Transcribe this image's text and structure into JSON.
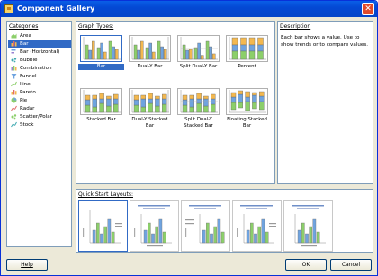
{
  "window": {
    "title": "Component Gallery",
    "close_glyph": "✕"
  },
  "categories": {
    "header": "Categories",
    "items": [
      {
        "label": "Area",
        "icon": "area-chart-icon"
      },
      {
        "label": "Bar",
        "icon": "bar-chart-icon",
        "selected": true
      },
      {
        "label": "Bar (Horizontal)",
        "icon": "horizontal-bar-chart-icon"
      },
      {
        "label": "Bubble",
        "icon": "bubble-chart-icon"
      },
      {
        "label": "Combination",
        "icon": "combination-chart-icon"
      },
      {
        "label": "Funnel",
        "icon": "funnel-chart-icon"
      },
      {
        "label": "Line",
        "icon": "line-chart-icon"
      },
      {
        "label": "Pareto",
        "icon": "pareto-chart-icon"
      },
      {
        "label": "Pie",
        "icon": "pie-chart-icon"
      },
      {
        "label": "Radar",
        "icon": "radar-chart-icon"
      },
      {
        "label": "Scatter/Polar",
        "icon": "scatter-chart-icon"
      },
      {
        "label": "Stock",
        "icon": "stock-chart-icon"
      }
    ]
  },
  "graph_types": {
    "header": "Graph Types:",
    "items": [
      {
        "label": "Bar",
        "selected": true
      },
      {
        "label": "Dual-Y Bar"
      },
      {
        "label": "Split Dual-Y Bar"
      },
      {
        "label": "Percent"
      },
      {
        "label": "Stacked Bar"
      },
      {
        "label": "Dual-Y Stacked Bar"
      },
      {
        "label": "Split Dual-Y Stacked Bar"
      },
      {
        "label": "Floating Stacked Bar"
      }
    ]
  },
  "description": {
    "header": "Description",
    "text": "Each bar shows a value. Use to show trends or to compare values."
  },
  "quick_start": {
    "header": "Quick Start Layouts:",
    "count": 5,
    "selected_index": 0
  },
  "buttons": {
    "help": "Help",
    "ok": "OK",
    "cancel": "Cancel"
  },
  "colors": {
    "selection": "#316ac5",
    "bar_green": "#8ccf6a",
    "bar_blue": "#6fa3df",
    "bar_orange": "#f3b84f",
    "title_bar": "#0449d4"
  }
}
